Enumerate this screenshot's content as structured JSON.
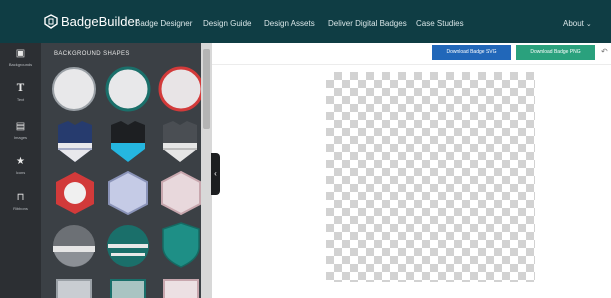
{
  "header": {
    "brand_prefix": "",
    "brand": "BadgeBuilder",
    "nav": [
      "Badge Designer",
      "Design Guide",
      "Design Assets",
      "Deliver Digital Badges",
      "Case Studies"
    ],
    "about": "About"
  },
  "rail": {
    "items": [
      {
        "icon": "image-icon",
        "label": "Backgrounds"
      },
      {
        "icon": "text-icon",
        "label": "Text"
      },
      {
        "icon": "picture-icon",
        "label": "Images"
      },
      {
        "icon": "star-icon",
        "label": "Icons"
      },
      {
        "icon": "bookmark-icon",
        "label": "Ribbons"
      }
    ]
  },
  "panel": {
    "title": "BACKGROUND SHAPES"
  },
  "toolbar": {
    "download_svg": "Download Badge SVG",
    "download_png": "Download Badge PNG"
  },
  "footer": {
    "note": ""
  },
  "colors": {
    "nav_bg": "#0f3d44",
    "rail_bg": "#2c2f33",
    "panel_bg": "#3b4045",
    "svg_button": "#2167b9",
    "png_button": "#2aa17d",
    "accent_teal": "#1a6f6a",
    "accent_red": "#d23a3a",
    "accent_navy": "#263b6e",
    "accent_cyan": "#25b6e0"
  }
}
